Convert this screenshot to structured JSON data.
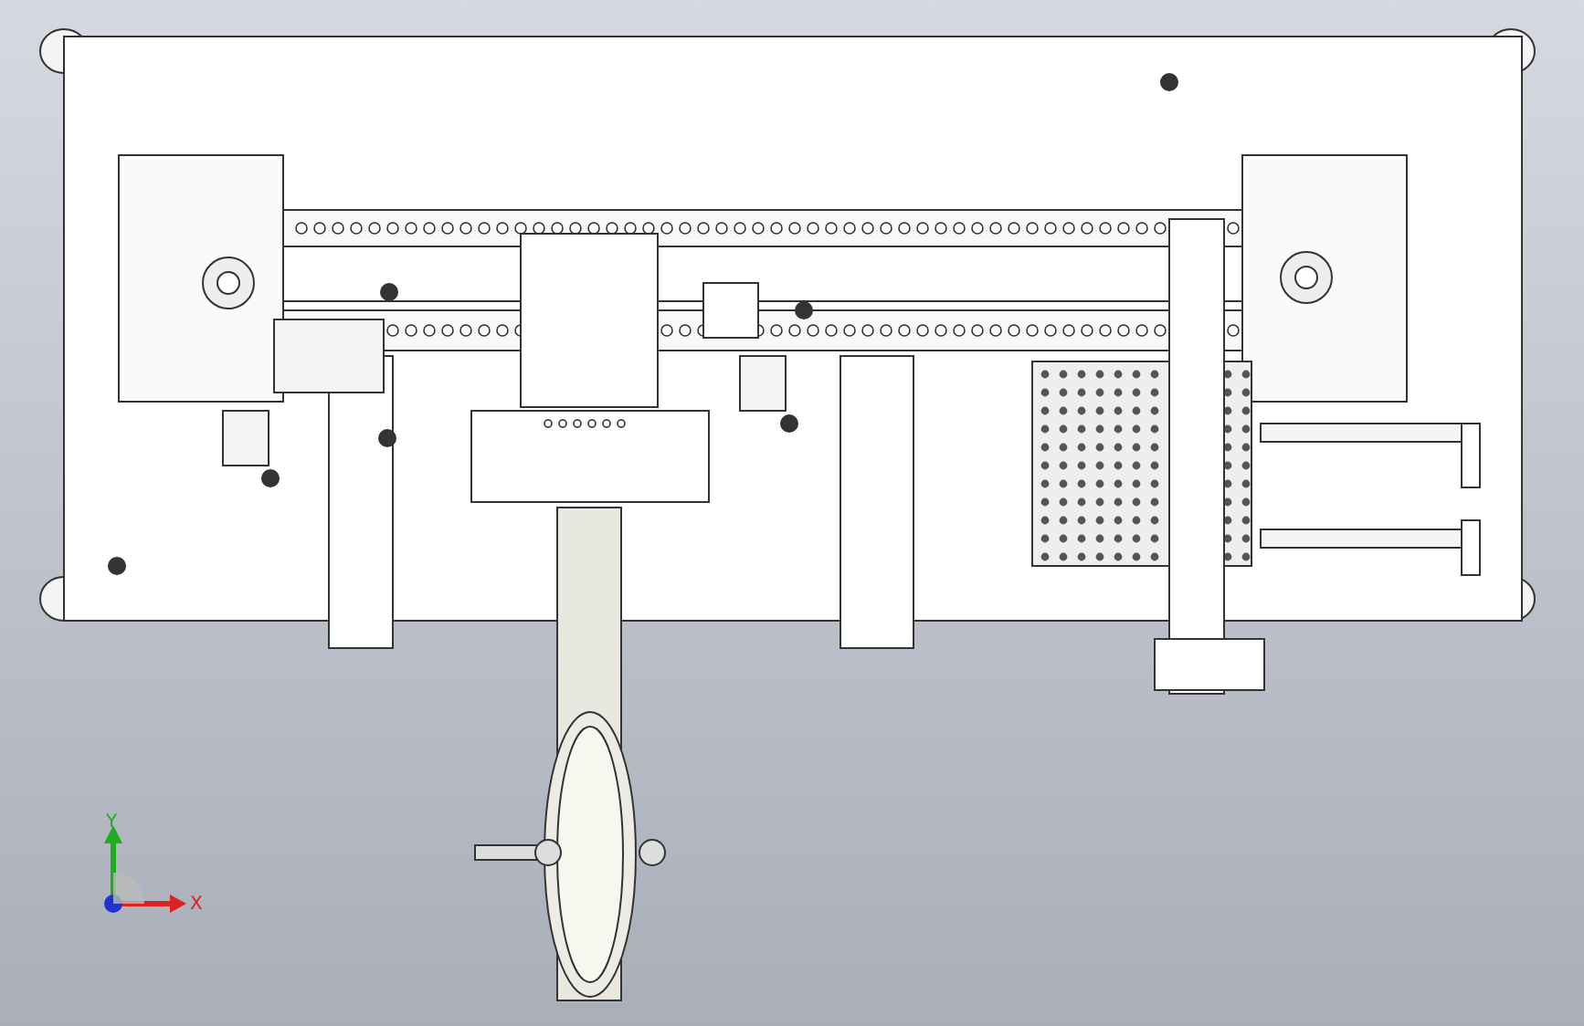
{
  "viewport": {
    "triad": {
      "y_label": "Y",
      "x_label": "X"
    }
  }
}
